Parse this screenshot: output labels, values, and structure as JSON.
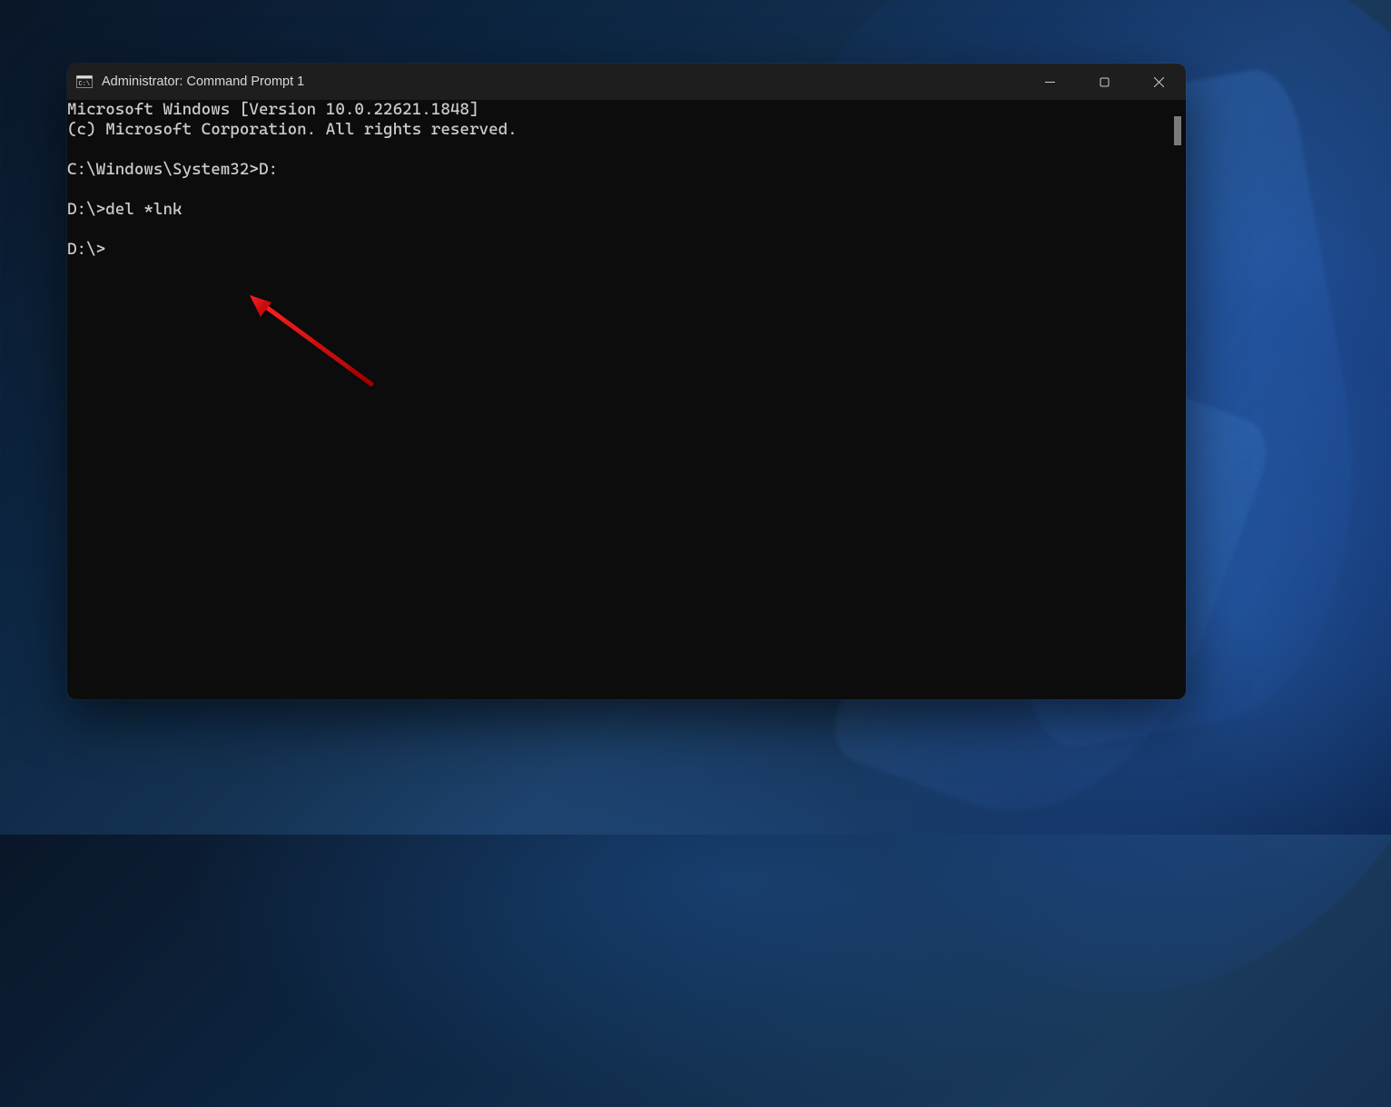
{
  "window": {
    "title": "Administrator: Command Prompt 1"
  },
  "terminal": {
    "lines": [
      "Microsoft Windows [Version 10.0.22621.1848]",
      "(c) Microsoft Corporation. All rights reserved.",
      "",
      "C:\\Windows\\System32>D:",
      "",
      "D:\\>del *lnk",
      "",
      "D:\\>"
    ]
  }
}
